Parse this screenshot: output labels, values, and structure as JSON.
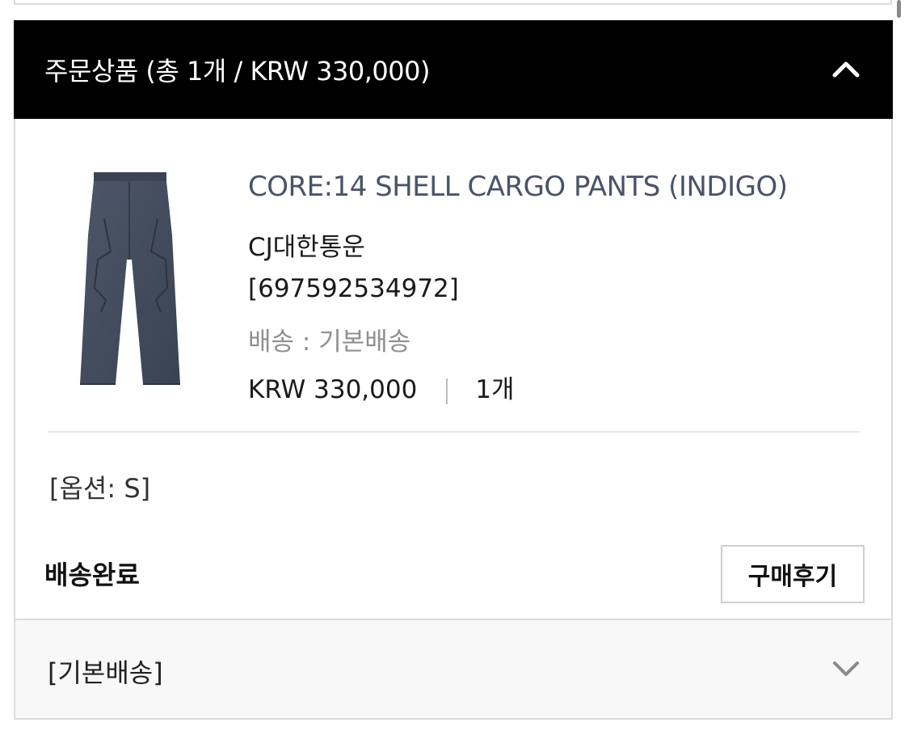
{
  "order": {
    "header_title": "주문상품 (총 1개 / KRW 330,000)",
    "collapse_icon": "chevron-up-icon"
  },
  "item": {
    "name": "CORE:14 SHELL CARGO PANTS (INDIGO)",
    "courier": "CJ대한통운",
    "tracking": "[697592534972]",
    "shipping": "배송 : 기본배송",
    "price": "KRW 330,000",
    "quantity": "1개",
    "option": "[옵션: S]",
    "status": "배송완료",
    "review_button": "구매후기",
    "image": "indigo-cargo-pants"
  },
  "shipping_section": {
    "label": "[기본배송]",
    "expand_icon": "chevron-down-icon"
  },
  "colors": {
    "header_bg": "#000000",
    "product_name": "#4a5368",
    "muted_text": "#8f8f8f"
  }
}
